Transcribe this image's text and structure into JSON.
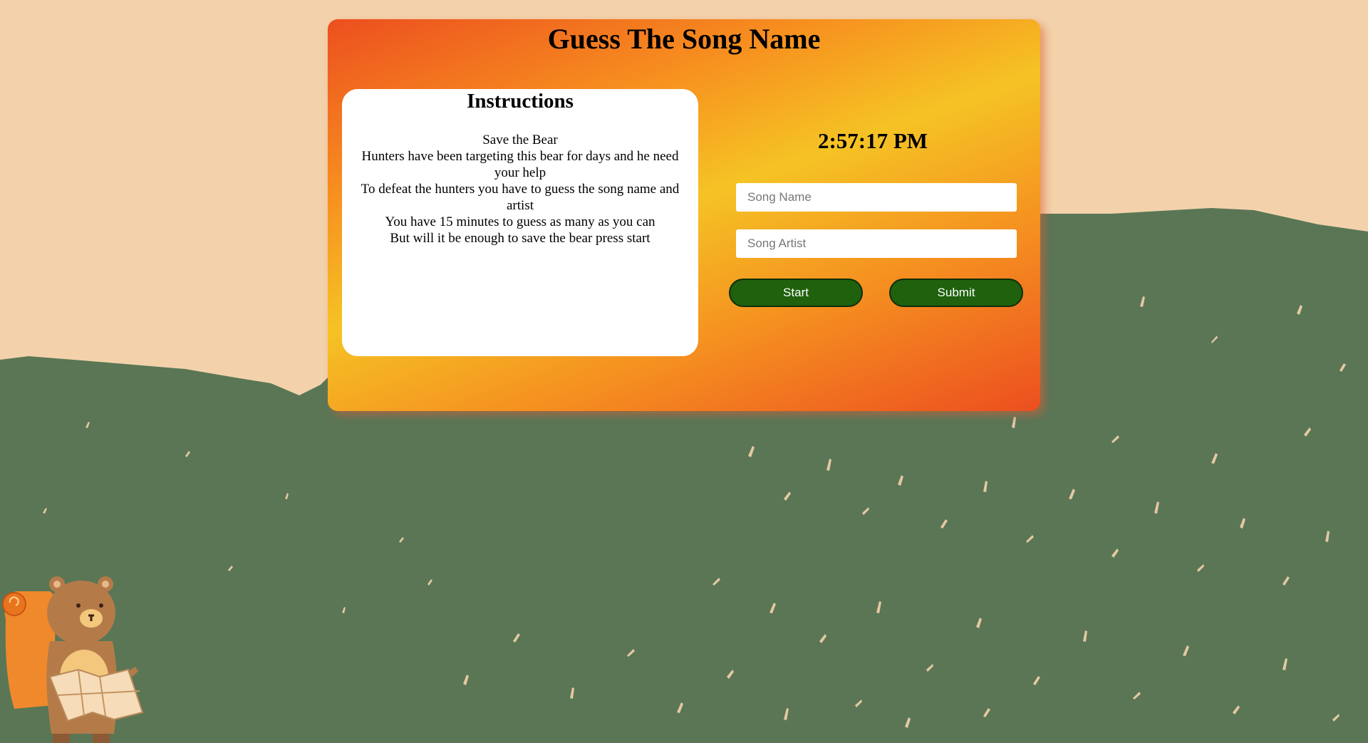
{
  "page": {
    "title": "Guess The Song Name"
  },
  "instructions": {
    "heading": "Instructions",
    "lines": [
      "Save the Bear",
      "Hunters have been targeting this bear for days and he need your help",
      "To defeat the hunters you have to guess the song name and artist",
      "You have 15 minutes to guess as many as you can",
      "But will it be enough to save the bear press start"
    ]
  },
  "clock": {
    "time": "2:57:17 PM"
  },
  "form": {
    "song_name_placeholder": "Song Name",
    "song_name_value": "",
    "song_artist_placeholder": "Song Artist",
    "song_artist_value": "",
    "start_label": "Start",
    "submit_label": "Submit"
  },
  "colors": {
    "background": "#f3d2ab",
    "hills": "#5a7655",
    "button": "#1f610d",
    "gradient_orange": "#ec4f1f",
    "gradient_yellow": "#f5c324"
  },
  "icons": {
    "mascot": "bear-with-map-illustration"
  }
}
